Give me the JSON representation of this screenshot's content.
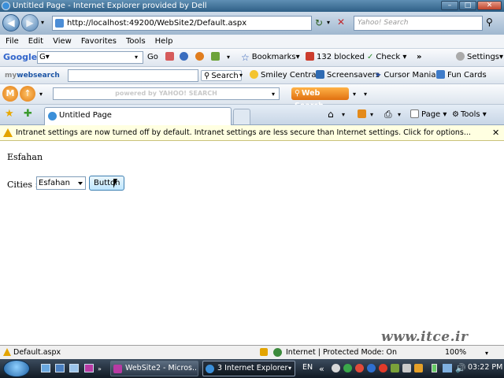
{
  "window": {
    "title": "Untitled Page - Internet Explorer provided by Dell",
    "controls": [
      "–",
      "□",
      "✕"
    ]
  },
  "address_bar": {
    "url": "http://localhost:49200/WebSite2/Default.aspx",
    "search_placeholder": "Yahoo! Search"
  },
  "menu": [
    "File",
    "Edit",
    "View",
    "Favorites",
    "Tools",
    "Help"
  ],
  "google_toolbar": {
    "logo": "Google",
    "search_value": "G▾",
    "go_label": "Go",
    "bookmarks_label": "Bookmarks▾",
    "blocked_label": "132 blocked",
    "check_label": "Check ▾",
    "more_label": "»",
    "settings_label": "Settings▾"
  },
  "mywebsearch_toolbar": {
    "logo_prefix": "my",
    "logo_main": "websearch",
    "search_label": "Search",
    "items": [
      "Smiley Central",
      "Screensavers",
      "Cursor Mania",
      "Fun Cards"
    ]
  },
  "yahoo_toolbar": {
    "logo_text": "powered by YAHOO! SEARCH",
    "web_search_label": "Web Search"
  },
  "tabs": {
    "active_tab": "Untitled Page",
    "right_items": [
      "Page ▾",
      "Tools ▾"
    ]
  },
  "infobar": {
    "message": "Intranet settings are now turned off by default. Intranet settings are less secure than Internet settings. Click for options...",
    "close": "✕"
  },
  "page": {
    "heading": "Esfahan",
    "cities_label": "Cities :",
    "select_value": "Esfahan",
    "button_label": "Button"
  },
  "statusbar": {
    "left_text": "Default.aspx",
    "zone_text": "Internet | Protected Mode: On",
    "zoom": "100%"
  },
  "watermark": "www.itce.ir",
  "taskbar": {
    "tasks": [
      "WebSite2 - Micros...",
      "3 Internet Explorer"
    ],
    "lang": "EN",
    "clock": "03:22 PM"
  }
}
